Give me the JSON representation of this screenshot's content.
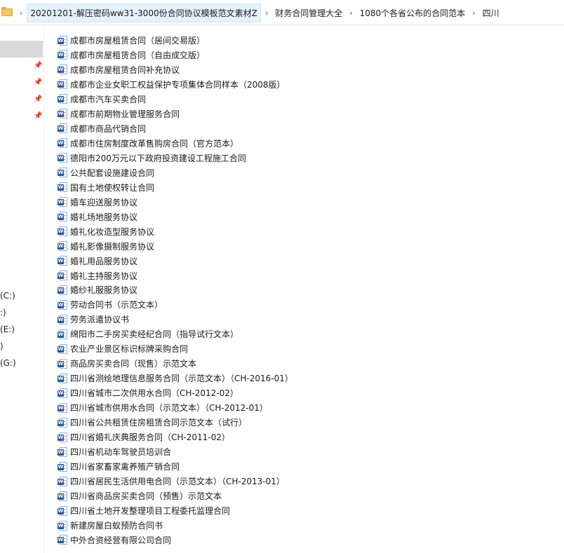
{
  "breadcrumb": {
    "items": [
      "20201201-解压密码ww31-3000份合同协议模板范文素材Z",
      "财务合同管理大全",
      "1080个各省公布的合同范本",
      "四川"
    ]
  },
  "nav": {
    "drives": [
      "(C:)",
      ":)",
      "(E:)",
      ")",
      "(G:)"
    ]
  },
  "files": [
    "成都市房屋租赁合同（居间交易版）",
    "成都市房屋租赁合同（自由成交版）",
    "成都市房屋租赁合同补充协议",
    "成都市企业女职工权益保护专项集体合同样本（2008版）",
    "成都市汽车买卖合同",
    "成都市前期物业管理服务合同",
    "成都市商品代销合同",
    "成都市住房制度改革售购房合同（官方范本）",
    "德阳市200万元以下政府投资建设工程施工合同",
    "公共配套设施建设合同",
    "国有土地使权转让合同",
    "婚车迎送服务协议",
    "婚礼场地服务协议",
    "婚礼化妆造型服务协议",
    "婚礼影像摄制服务协议",
    "婚礼用品服务协议",
    "婚礼主持服务协议",
    "婚纱礼服服务协议",
    "劳动合同书（示范文本）",
    "劳务派遣协议书",
    "绵阳市二手房买卖经纪合同（指导试行文本）",
    "农业产业景区标识标牌采购合同",
    "商品房买卖合同（现售）示范文本",
    "四川省测绘地理信息服务合同（示范文本）（CH-2016-01）",
    "四川省城市二次供用水合同（CH-2012-02）",
    "四川省城市供用水合同（示范文本）（CH-2012-01）",
    "四川省公共租赁住房租赁合同示范文本（试行）",
    "四川省婚礼庆典服务合同（CH-2011-02）",
    "四川省机动车驾驶员培训合",
    "四川省家畜家禽养殖产销合同",
    "四川省居民生活供用电合同（示范文本）（CH-2013-01）",
    "四川省商品房买卖合同（预售）示范文本",
    "四川省土地开发整理项目工程委托监理合同",
    "新建房屋白蚁预防合同书",
    "中外合资经营有限公司合同"
  ]
}
